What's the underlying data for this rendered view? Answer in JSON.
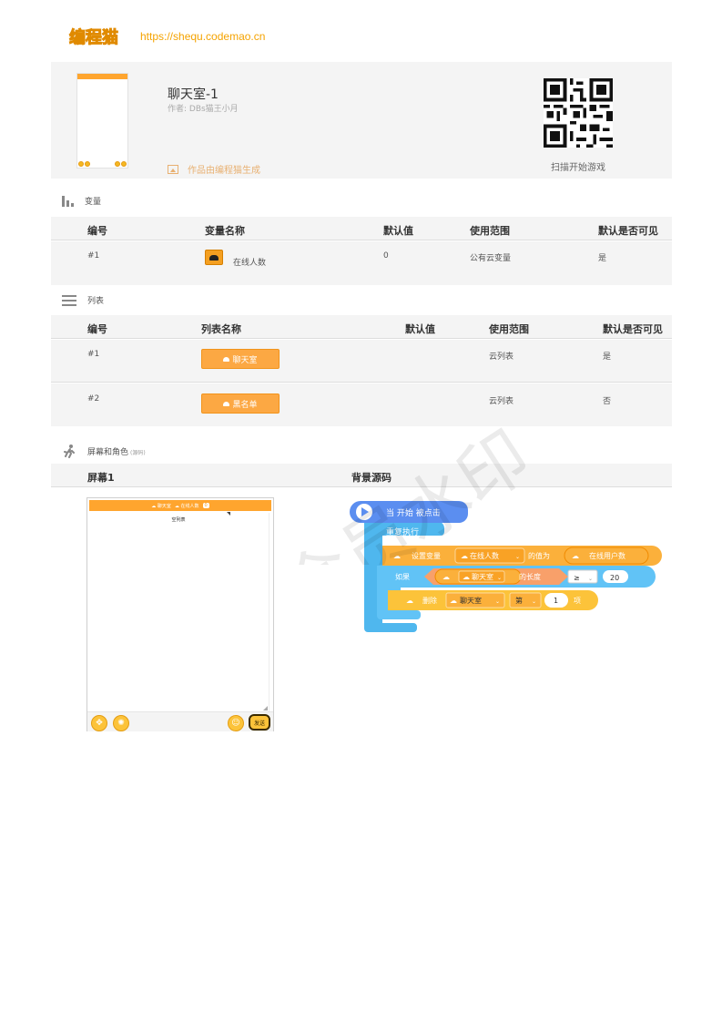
{
  "header": {
    "logo": "编程猫",
    "url": "https://shequ.codemao.cn"
  },
  "project": {
    "title": "聊天室-1",
    "author": "作者: DBs猫王小月",
    "generated_by": "作品由编程猫生成",
    "qr_caption": "扫描开始游戏"
  },
  "variables": {
    "section_title": "变量",
    "headers": [
      "编号",
      "变量名称",
      "默认值",
      "使用范围",
      "默认是否可见"
    ],
    "rows": [
      {
        "id": "#1",
        "name": "在线人数",
        "default": "0",
        "scope": "公有云变量",
        "visible": "是"
      }
    ]
  },
  "lists": {
    "section_title": "列表",
    "headers": [
      "编号",
      "列表名称",
      "默认值",
      "使用范围",
      "默认是否可见"
    ],
    "rows": [
      {
        "id": "#1",
        "name": "聊天室",
        "default": "",
        "scope": "云列表",
        "visible": "是"
      },
      {
        "id": "#2",
        "name": "黑名单",
        "default": "",
        "scope": "云列表",
        "visible": "否"
      }
    ]
  },
  "screens": {
    "section_title": "屏幕和角色",
    "section_note": "(源码)",
    "headers": [
      "屏幕1",
      "背景源码"
    ],
    "phone": {
      "tag_chat": "聊天室",
      "tag_online": "在线人数",
      "online_value": "0",
      "list_title": "空列表",
      "send_label": "发送"
    }
  },
  "code": {
    "hat": "当 开始 被点击",
    "loop": "重复执行",
    "set_var": {
      "prefix": "设置变量",
      "var": "在线人数",
      "middle": "的值为",
      "value": "在线用户数"
    },
    "if_block": {
      "prefix": "如果",
      "list": "聊天室",
      "middle": "的长度",
      "op": "≥",
      "value": "20"
    },
    "delete": {
      "prefix": "删除",
      "list": "聊天室",
      "index_label": "第",
      "index": "1",
      "suffix": "项"
    }
  },
  "watermark": "非会员水印",
  "colors": {
    "accent": "#ffa52e",
    "event_blue": "#5b8ef0",
    "control_cyan": "#61c3f6",
    "data_orange": "#fbb03b"
  }
}
